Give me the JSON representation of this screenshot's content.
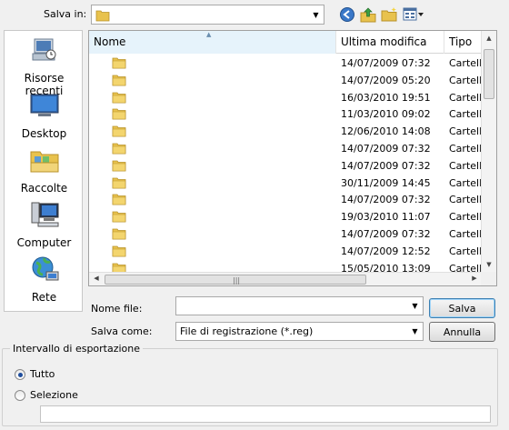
{
  "header": {
    "save_in_label": "Salva in:",
    "save_in_value": ""
  },
  "toolbar": {
    "back_icon": "back-arrow-icon",
    "up_icon": "up-folder-icon",
    "new_folder_icon": "new-folder-icon",
    "view_icon": "view-menu-icon"
  },
  "places": [
    {
      "label": "Risorse recenti",
      "icon": "recent-places-icon"
    },
    {
      "label": "Desktop",
      "icon": "desktop-icon"
    },
    {
      "label": "Raccolte",
      "icon": "libraries-icon"
    },
    {
      "label": "Computer",
      "icon": "computer-icon"
    },
    {
      "label": "Rete",
      "icon": "network-icon"
    }
  ],
  "columns": {
    "name": "Nome",
    "modified": "Ultima modifica",
    "type": "Tipo"
  },
  "rows": [
    {
      "name": "",
      "modified": "14/07/2009 07:32",
      "type": "Cartella"
    },
    {
      "name": "",
      "modified": "14/07/2009 05:20",
      "type": "Cartella"
    },
    {
      "name": "",
      "modified": "16/03/2010 19:51",
      "type": "Cartella"
    },
    {
      "name": "",
      "modified": "11/03/2010 09:02",
      "type": "Cartella"
    },
    {
      "name": "",
      "modified": "12/06/2010 14:08",
      "type": "Cartella"
    },
    {
      "name": "",
      "modified": "14/07/2009 07:32",
      "type": "Cartella"
    },
    {
      "name": "",
      "modified": "14/07/2009 07:32",
      "type": "Cartella"
    },
    {
      "name": "",
      "modified": "30/11/2009 14:45",
      "type": "Cartella"
    },
    {
      "name": "",
      "modified": "14/07/2009 07:32",
      "type": "Cartella"
    },
    {
      "name": "",
      "modified": "19/03/2010 11:07",
      "type": "Cartella"
    },
    {
      "name": "",
      "modified": "14/07/2009 07:32",
      "type": "Cartella"
    },
    {
      "name": "",
      "modified": "14/07/2009 12:52",
      "type": "Cartella"
    },
    {
      "name": "",
      "modified": "15/05/2010 13:09",
      "type": "Cartella"
    }
  ],
  "form": {
    "filename_label": "Nome file:",
    "filename_value": "",
    "savetype_label": "Salva come:",
    "savetype_value": "File di registrazione (*.reg)",
    "save_button": "Salva",
    "cancel_button": "Annulla"
  },
  "export": {
    "title": "Intervallo di esportazione",
    "all_label": "Tutto",
    "selection_label": "Selezione",
    "selected": "all",
    "selection_value": ""
  },
  "colors": {
    "folder": "#e8c24d",
    "accent": "#3c7fb1"
  }
}
